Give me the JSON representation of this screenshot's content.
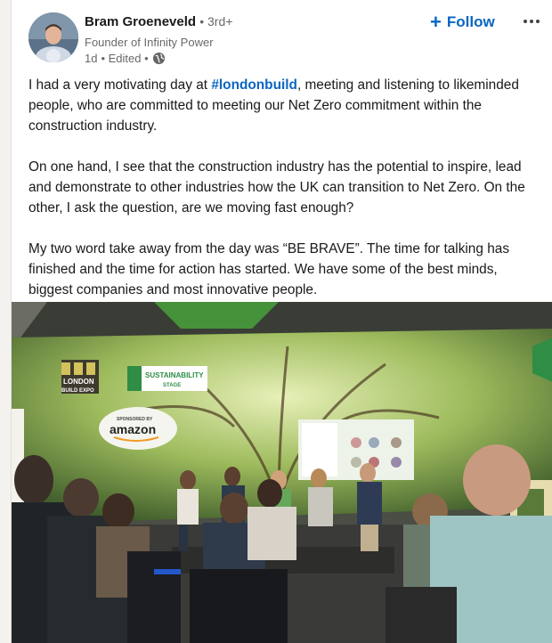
{
  "post": {
    "author": {
      "name": "Bram Groeneveld",
      "degree": "• 3rd+",
      "headline": "Founder of Infinity Power",
      "time": "1d",
      "edited": "• Edited •",
      "visibility_icon": "globe-icon"
    },
    "actions": {
      "follow_label": "Follow",
      "follow_icon": "plus-icon",
      "more_icon": "more-options-icon"
    },
    "body": {
      "p1_before": "I had a very motivating day at ",
      "hashtag": "#londonbuild",
      "p1_after": ", meeting and listening to likeminded people, who are committed to meeting our Net Zero commitment within the construction industry.",
      "p2": "On one hand, I see that the construction industry has the potential to inspire, lead and demonstrate to other industries how the UK can transition to Net Zero. On the other, I ask the question, are we moving fast enough?",
      "p3": "My two word take away from the day was “BE BRAVE”. The time for talking has finished and the time for action has started.  We have some of the best minds, biggest companies and most innovative people."
    },
    "image": {
      "sign_london_1": "LONDON",
      "sign_london_2": "BUILD EXPO",
      "sign_stage_1": "SUSTAINABILITY",
      "sign_stage_2": "STAGE",
      "sign_sponsor_small": "SPONSORED BY",
      "sign_sponsor": "amazon"
    }
  },
  "colors": {
    "accent": "#0a66c2",
    "card_bg": "#ffffff",
    "page_bg": "#f3f2ef"
  }
}
